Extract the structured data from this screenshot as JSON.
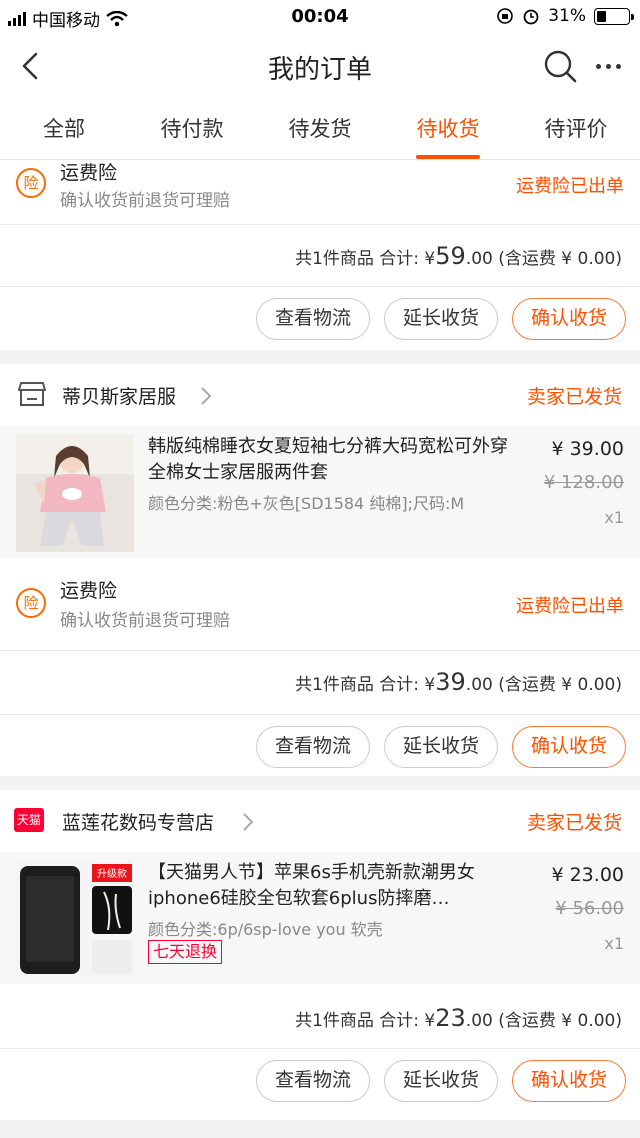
{
  "status_bar": {
    "carrier": "中国移动",
    "time": "00:04",
    "battery": "31%",
    "battery_level": 0.31
  },
  "nav": {
    "title": "我的订单"
  },
  "tabs": [
    {
      "label": "全部"
    },
    {
      "label": "待付款"
    },
    {
      "label": "待发货"
    },
    {
      "label": "待收货"
    },
    {
      "label": "待评价"
    }
  ],
  "orders": [
    {
      "insurance": {
        "badge": "险",
        "title": "运费险",
        "sub": "确认收货前退货可理赔",
        "status": "运费险已出单"
      },
      "summary": {
        "count_text": "共1件商品 合计: ¥",
        "amount_int": "59",
        "amount_dec": ".00",
        "shipping": " (含运费 ¥ 0.00)"
      },
      "buttons": {
        "logistics": "查看物流",
        "extend": "延长收货",
        "confirm": "确认收货"
      }
    },
    {
      "shop": {
        "name": "蒂贝斯家居服",
        "status": "卖家已发货"
      },
      "item": {
        "title": "韩版纯棉睡衣女夏短袖七分裤大码宽松可外穿全棉女士家居服两件套",
        "spec": "颜色分类:粉色+灰色[SD1584 纯棉];尺码:M",
        "price": "¥ 39.00",
        "orig_price": "¥ 128.00",
        "qty": "x1"
      },
      "insurance": {
        "badge": "险",
        "title": "运费险",
        "sub": "确认收货前退货可理赔",
        "status": "运费险已出单"
      },
      "summary": {
        "count_text": "共1件商品 合计: ¥",
        "amount_int": "39",
        "amount_dec": ".00",
        "shipping": " (含运费 ¥ 0.00)"
      },
      "buttons": {
        "logistics": "查看物流",
        "extend": "延长收货",
        "confirm": "确认收货"
      }
    },
    {
      "shop": {
        "name": "蓝莲花数码专营店",
        "status": "卖家已发货",
        "badge": "天猫"
      },
      "item": {
        "title": "【天猫男人节】苹果6s手机壳新款潮男女iphone6硅胶全包软套6plus防摔磨…",
        "spec": "颜色分类:6p/6sp-love you 软壳",
        "tag": "七天退换",
        "price": "¥ 23.00",
        "orig_price": "¥ 56.00",
        "qty": "x1",
        "thumb_label": "升级款"
      },
      "summary": {
        "count_text": "共1件商品 合计: ¥",
        "amount_int": "23",
        "amount_dec": ".00",
        "shipping": " (含运费 ¥ 0.00)"
      },
      "buttons": {
        "logistics": "查看物流",
        "extend": "延长收货",
        "confirm": "确认收货"
      }
    }
  ],
  "colors": {
    "accent": "#ff5000",
    "tmall": "#ff0036"
  }
}
